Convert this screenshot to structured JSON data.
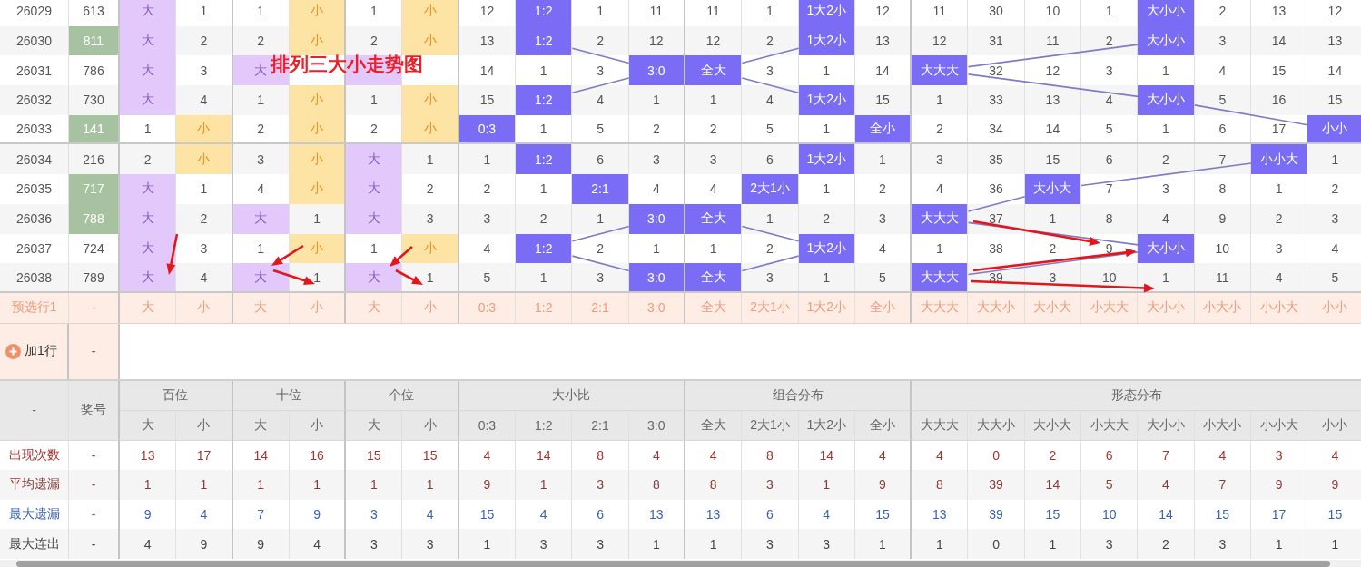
{
  "title": "排列三大小走势图",
  "groups": [
    {
      "label": "百位",
      "kind": "position",
      "columns": [
        {
          "label": "大",
          "kind": "big"
        },
        {
          "label": "小",
          "kind": "small"
        }
      ]
    },
    {
      "label": "十位",
      "kind": "position",
      "columns": [
        {
          "label": "大",
          "kind": "big"
        },
        {
          "label": "小",
          "kind": "small"
        }
      ]
    },
    {
      "label": "个位",
      "kind": "position",
      "columns": [
        {
          "label": "大",
          "kind": "big"
        },
        {
          "label": "小",
          "kind": "small"
        }
      ]
    },
    {
      "label": "大小比",
      "kind": "trend",
      "columns": [
        {
          "label": "0:3"
        },
        {
          "label": "1:2"
        },
        {
          "label": "2:1"
        },
        {
          "label": "3:0"
        }
      ]
    },
    {
      "label": "组合分布",
      "kind": "trend",
      "columns": [
        {
          "label": "全大"
        },
        {
          "label": "2大1小"
        },
        {
          "label": "1大2小"
        },
        {
          "label": "全小"
        }
      ]
    },
    {
      "label": "形态分布",
      "kind": "trend",
      "columns": [
        {
          "label": "大大大"
        },
        {
          "label": "大大小"
        },
        {
          "label": "大小大"
        },
        {
          "label": "小大大"
        },
        {
          "label": "大小小"
        },
        {
          "label": "小大小"
        },
        {
          "label": "小小大"
        },
        {
          "label": "小小"
        }
      ]
    }
  ],
  "rows": [
    {
      "issue": "26029",
      "number": "613",
      "highlighted": false,
      "cells": [
        {
          "text": "大",
          "hit": true
        },
        {
          "text": "1",
          "hit": false
        },
        {
          "text": "1",
          "hit": false
        },
        {
          "text": "小",
          "hit": true
        },
        {
          "text": "1",
          "hit": false
        },
        {
          "text": "小",
          "hit": true
        },
        {
          "text": "12",
          "hit": false
        },
        {
          "text": "1:2",
          "hit": true
        },
        {
          "text": "1",
          "hit": false
        },
        {
          "text": "11",
          "hit": false
        },
        {
          "text": "11",
          "hit": false
        },
        {
          "text": "1",
          "hit": false
        },
        {
          "text": "1大2小",
          "hit": true
        },
        {
          "text": "12",
          "hit": false
        },
        {
          "text": "11",
          "hit": false
        },
        {
          "text": "30",
          "hit": false
        },
        {
          "text": "10",
          "hit": false
        },
        {
          "text": "1",
          "hit": false
        },
        {
          "text": "大小小",
          "hit": true
        },
        {
          "text": "2",
          "hit": false
        },
        {
          "text": "13",
          "hit": false
        },
        {
          "text": "12",
          "hit": false
        }
      ]
    },
    {
      "issue": "26030",
      "number": "811",
      "highlighted": true,
      "cells": [
        {
          "text": "大",
          "hit": true
        },
        {
          "text": "2",
          "hit": false
        },
        {
          "text": "2",
          "hit": false
        },
        {
          "text": "小",
          "hit": true
        },
        {
          "text": "2",
          "hit": false
        },
        {
          "text": "小",
          "hit": true
        },
        {
          "text": "13",
          "hit": false
        },
        {
          "text": "1:2",
          "hit": true
        },
        {
          "text": "2",
          "hit": false
        },
        {
          "text": "12",
          "hit": false
        },
        {
          "text": "12",
          "hit": false
        },
        {
          "text": "2",
          "hit": false
        },
        {
          "text": "1大2小",
          "hit": true
        },
        {
          "text": "13",
          "hit": false
        },
        {
          "text": "12",
          "hit": false
        },
        {
          "text": "31",
          "hit": false
        },
        {
          "text": "11",
          "hit": false
        },
        {
          "text": "2",
          "hit": false
        },
        {
          "text": "大小小",
          "hit": true
        },
        {
          "text": "3",
          "hit": false
        },
        {
          "text": "14",
          "hit": false
        },
        {
          "text": "13",
          "hit": false
        }
      ]
    },
    {
      "issue": "26031",
      "number": "786",
      "highlighted": false,
      "cells": [
        {
          "text": "大",
          "hit": true
        },
        {
          "text": "3",
          "hit": false
        },
        {
          "text": "大",
          "hit": true
        },
        {
          "hit": false
        },
        {
          "hit": true
        },
        {
          "hit": false
        },
        {
          "text": "14",
          "hit": false
        },
        {
          "text": "1",
          "hit": false
        },
        {
          "text": "3",
          "hit": false
        },
        {
          "text": "3:0",
          "hit": true
        },
        {
          "text": "全大",
          "hit": true
        },
        {
          "text": "3",
          "hit": false
        },
        {
          "text": "1",
          "hit": false
        },
        {
          "text": "14",
          "hit": false
        },
        {
          "text": "大大大",
          "hit": true
        },
        {
          "text": "32",
          "hit": false
        },
        {
          "text": "12",
          "hit": false
        },
        {
          "text": "3",
          "hit": false
        },
        {
          "text": "1",
          "hit": false
        },
        {
          "text": "4",
          "hit": false
        },
        {
          "text": "15",
          "hit": false
        },
        {
          "text": "14",
          "hit": false
        }
      ]
    },
    {
      "issue": "26032",
      "number": "730",
      "highlighted": false,
      "cells": [
        {
          "text": "大",
          "hit": true
        },
        {
          "text": "4",
          "hit": false
        },
        {
          "text": "1",
          "hit": false
        },
        {
          "text": "小",
          "hit": true
        },
        {
          "text": "1",
          "hit": false
        },
        {
          "text": "小",
          "hit": true
        },
        {
          "text": "15",
          "hit": false
        },
        {
          "text": "1:2",
          "hit": true
        },
        {
          "text": "4",
          "hit": false
        },
        {
          "text": "1",
          "hit": false
        },
        {
          "text": "1",
          "hit": false
        },
        {
          "text": "4",
          "hit": false
        },
        {
          "text": "1大2小",
          "hit": true
        },
        {
          "text": "15",
          "hit": false
        },
        {
          "text": "1",
          "hit": false
        },
        {
          "text": "33",
          "hit": false
        },
        {
          "text": "13",
          "hit": false
        },
        {
          "text": "4",
          "hit": false
        },
        {
          "text": "大小小",
          "hit": true
        },
        {
          "text": "5",
          "hit": false
        },
        {
          "text": "16",
          "hit": false
        },
        {
          "text": "15",
          "hit": false
        }
      ]
    },
    {
      "issue": "26033",
      "number": "141",
      "highlighted": true,
      "cells": [
        {
          "text": "1",
          "hit": false
        },
        {
          "text": "小",
          "hit": true
        },
        {
          "text": "2",
          "hit": false
        },
        {
          "text": "小",
          "hit": true
        },
        {
          "text": "2",
          "hit": false
        },
        {
          "text": "小",
          "hit": true
        },
        {
          "text": "0:3",
          "hit": true
        },
        {
          "text": "1",
          "hit": false
        },
        {
          "text": "5",
          "hit": false
        },
        {
          "text": "2",
          "hit": false
        },
        {
          "text": "2",
          "hit": false
        },
        {
          "text": "5",
          "hit": false
        },
        {
          "text": "1",
          "hit": false
        },
        {
          "text": "全小",
          "hit": true
        },
        {
          "text": "2",
          "hit": false
        },
        {
          "text": "34",
          "hit": false
        },
        {
          "text": "14",
          "hit": false
        },
        {
          "text": "5",
          "hit": false
        },
        {
          "text": "1",
          "hit": false
        },
        {
          "text": "6",
          "hit": false
        },
        {
          "text": "17",
          "hit": false
        },
        {
          "text": "小小",
          "hit": true
        }
      ]
    },
    {
      "issue": "26034",
      "number": "216",
      "highlighted": false,
      "cells": [
        {
          "text": "2",
          "hit": false
        },
        {
          "text": "小",
          "hit": true
        },
        {
          "text": "3",
          "hit": false
        },
        {
          "text": "小",
          "hit": true
        },
        {
          "text": "大",
          "hit": true
        },
        {
          "text": "1",
          "hit": false
        },
        {
          "text": "1",
          "hit": false
        },
        {
          "text": "1:2",
          "hit": true
        },
        {
          "text": "6",
          "hit": false
        },
        {
          "text": "3",
          "hit": false
        },
        {
          "text": "3",
          "hit": false
        },
        {
          "text": "6",
          "hit": false
        },
        {
          "text": "1大2小",
          "hit": true
        },
        {
          "text": "1",
          "hit": false
        },
        {
          "text": "3",
          "hit": false
        },
        {
          "text": "35",
          "hit": false
        },
        {
          "text": "15",
          "hit": false
        },
        {
          "text": "6",
          "hit": false
        },
        {
          "text": "2",
          "hit": false
        },
        {
          "text": "7",
          "hit": false
        },
        {
          "text": "小小大",
          "hit": true
        },
        {
          "text": "1",
          "hit": false
        }
      ]
    },
    {
      "issue": "26035",
      "number": "717",
      "highlighted": true,
      "cells": [
        {
          "text": "大",
          "hit": true
        },
        {
          "text": "1",
          "hit": false
        },
        {
          "text": "4",
          "hit": false
        },
        {
          "text": "小",
          "hit": true
        },
        {
          "text": "大",
          "hit": true
        },
        {
          "text": "2",
          "hit": false
        },
        {
          "text": "2",
          "hit": false
        },
        {
          "text": "1",
          "hit": false
        },
        {
          "text": "2:1",
          "hit": true
        },
        {
          "text": "4",
          "hit": false
        },
        {
          "text": "4",
          "hit": false
        },
        {
          "text": "2大1小",
          "hit": true
        },
        {
          "text": "1",
          "hit": false
        },
        {
          "text": "2",
          "hit": false
        },
        {
          "text": "4",
          "hit": false
        },
        {
          "text": "36",
          "hit": false
        },
        {
          "text": "大小大",
          "hit": true
        },
        {
          "text": "7",
          "hit": false
        },
        {
          "text": "3",
          "hit": false
        },
        {
          "text": "8",
          "hit": false
        },
        {
          "text": "1",
          "hit": false
        },
        {
          "text": "2",
          "hit": false
        }
      ]
    },
    {
      "issue": "26036",
      "number": "788",
      "highlighted": true,
      "cells": [
        {
          "text": "大",
          "hit": true
        },
        {
          "text": "2",
          "hit": false
        },
        {
          "text": "大",
          "hit": true
        },
        {
          "text": "1",
          "hit": false
        },
        {
          "text": "大",
          "hit": true
        },
        {
          "text": "3",
          "hit": false
        },
        {
          "text": "3",
          "hit": false
        },
        {
          "text": "2",
          "hit": false
        },
        {
          "text": "1",
          "hit": false
        },
        {
          "text": "3:0",
          "hit": true
        },
        {
          "text": "全大",
          "hit": true
        },
        {
          "text": "1",
          "hit": false
        },
        {
          "text": "2",
          "hit": false
        },
        {
          "text": "3",
          "hit": false
        },
        {
          "text": "大大大",
          "hit": true
        },
        {
          "text": "37",
          "hit": false
        },
        {
          "text": "1",
          "hit": false
        },
        {
          "text": "8",
          "hit": false
        },
        {
          "text": "4",
          "hit": false
        },
        {
          "text": "9",
          "hit": false
        },
        {
          "text": "2",
          "hit": false
        },
        {
          "text": "3",
          "hit": false
        }
      ]
    },
    {
      "issue": "26037",
      "number": "724",
      "highlighted": false,
      "cells": [
        {
          "text": "大",
          "hit": true
        },
        {
          "text": "3",
          "hit": false
        },
        {
          "text": "1",
          "hit": false
        },
        {
          "text": "小",
          "hit": true
        },
        {
          "text": "1",
          "hit": false
        },
        {
          "text": "小",
          "hit": true
        },
        {
          "text": "4",
          "hit": false
        },
        {
          "text": "1:2",
          "hit": true
        },
        {
          "text": "2",
          "hit": false
        },
        {
          "text": "1",
          "hit": false
        },
        {
          "text": "1",
          "hit": false
        },
        {
          "text": "2",
          "hit": false
        },
        {
          "text": "1大2小",
          "hit": true
        },
        {
          "text": "4",
          "hit": false
        },
        {
          "text": "1",
          "hit": false
        },
        {
          "text": "38",
          "hit": false
        },
        {
          "text": "2",
          "hit": false
        },
        {
          "text": "9",
          "hit": false
        },
        {
          "text": "大小小",
          "hit": true
        },
        {
          "text": "10",
          "hit": false
        },
        {
          "text": "3",
          "hit": false
        },
        {
          "text": "4",
          "hit": false
        }
      ]
    },
    {
      "issue": "26038",
      "number": "789",
      "highlighted": false,
      "cells": [
        {
          "text": "大",
          "hit": true
        },
        {
          "text": "4",
          "hit": false
        },
        {
          "text": "大",
          "hit": true
        },
        {
          "text": "1",
          "hit": false
        },
        {
          "text": "大",
          "hit": true
        },
        {
          "text": "1",
          "hit": false
        },
        {
          "text": "5",
          "hit": false
        },
        {
          "text": "1",
          "hit": false
        },
        {
          "text": "3",
          "hit": false
        },
        {
          "text": "3:0",
          "hit": true
        },
        {
          "text": "全大",
          "hit": true
        },
        {
          "text": "3",
          "hit": false
        },
        {
          "text": "1",
          "hit": false
        },
        {
          "text": "5",
          "hit": false
        },
        {
          "text": "大大大",
          "hit": true
        },
        {
          "text": "39",
          "hit": false
        },
        {
          "text": "3",
          "hit": false
        },
        {
          "text": "10",
          "hit": false
        },
        {
          "text": "1",
          "hit": false
        },
        {
          "text": "11",
          "hit": false
        },
        {
          "text": "4",
          "hit": false
        },
        {
          "text": "5",
          "hit": false
        }
      ]
    }
  ],
  "preselect": {
    "label": "预选行1",
    "number": "-",
    "cells": [
      "大",
      "小",
      "大",
      "小",
      "大",
      "小",
      "0:3",
      "1:2",
      "2:1",
      "3:0",
      "全大",
      "2大1小",
      "1大2小",
      "全小",
      "大大大",
      "大大小",
      "大小大",
      "小大大",
      "大小小",
      "小大小",
      "小小大",
      "小小"
    ]
  },
  "add_row": {
    "label": "加1行",
    "number": "-"
  },
  "header": {
    "corner": "-",
    "number_label": "奖号"
  },
  "stats": [
    {
      "label": "出现次数",
      "kind": "count",
      "number": "-",
      "values": [
        "13",
        "17",
        "14",
        "16",
        "15",
        "15",
        "4",
        "14",
        "8",
        "4",
        "4",
        "8",
        "14",
        "4",
        "4",
        "0",
        "2",
        "6",
        "7",
        "4",
        "3",
        "4"
      ]
    },
    {
      "label": "平均遗漏",
      "kind": "average_miss",
      "number": "-",
      "values": [
        "1",
        "1",
        "1",
        "1",
        "1",
        "1",
        "9",
        "1",
        "3",
        "8",
        "8",
        "3",
        "1",
        "9",
        "8",
        "39",
        "14",
        "5",
        "4",
        "7",
        "9",
        "9"
      ]
    },
    {
      "label": "最大遗漏",
      "kind": "max_miss",
      "number": "-",
      "values": [
        "9",
        "4",
        "7",
        "9",
        "3",
        "4",
        "15",
        "4",
        "6",
        "13",
        "13",
        "6",
        "4",
        "15",
        "13",
        "39",
        "15",
        "10",
        "14",
        "15",
        "17",
        "15"
      ]
    },
    {
      "label": "最大连出",
      "kind": "max_streak",
      "number": "-",
      "values": [
        "4",
        "9",
        "9",
        "4",
        "3",
        "3",
        "1",
        "3",
        "3",
        "1",
        "1",
        "3",
        "3",
        "1",
        "1",
        "0",
        "1",
        "3",
        "2",
        "3",
        "1",
        "1"
      ]
    }
  ]
}
